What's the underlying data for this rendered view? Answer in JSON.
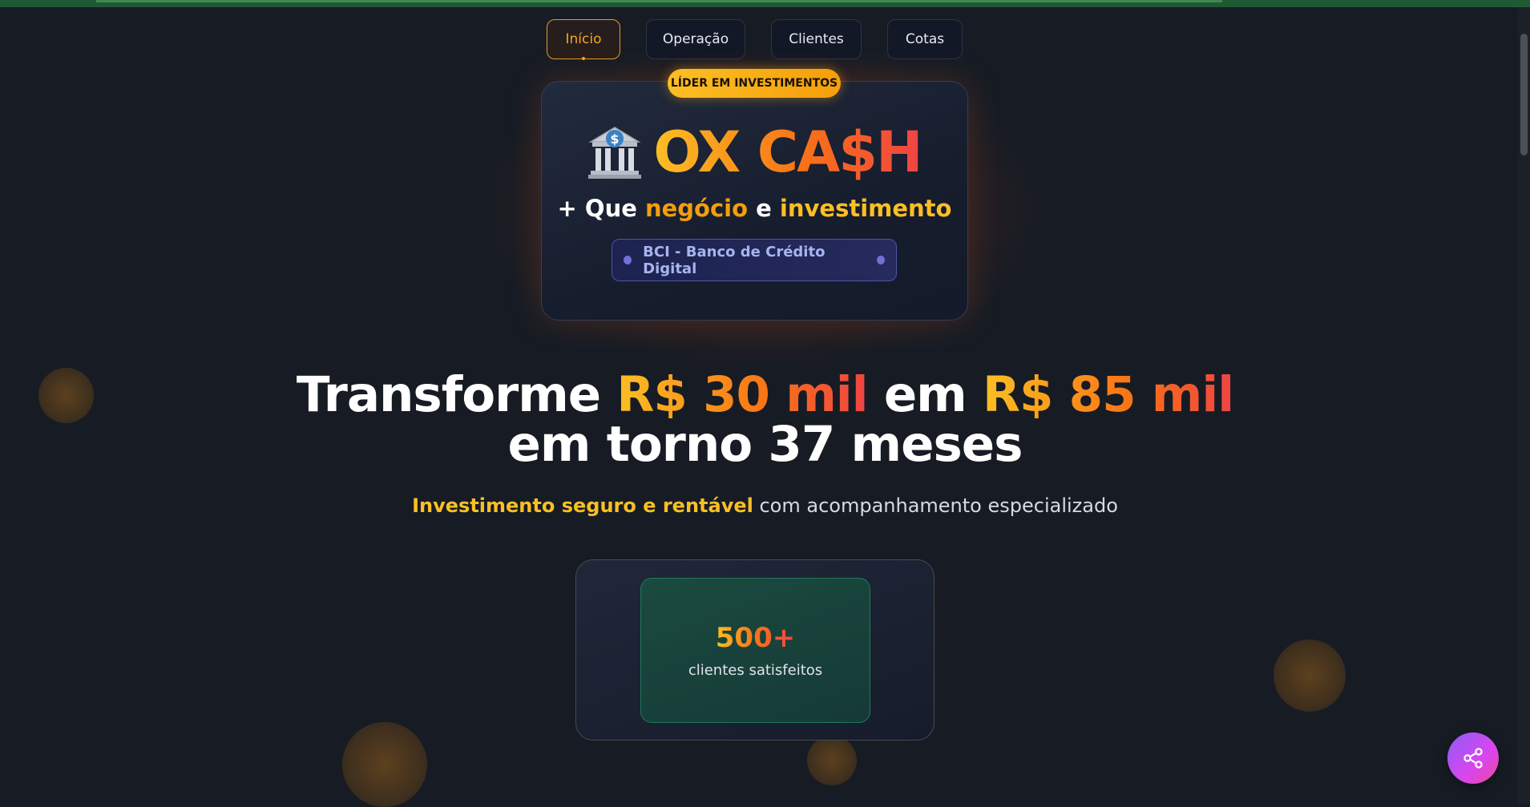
{
  "nav": {
    "items": [
      {
        "label": "Início",
        "active": true
      },
      {
        "label": "Operação",
        "active": false
      },
      {
        "label": "Clientes",
        "active": false
      },
      {
        "label": "Cotas",
        "active": false
      }
    ]
  },
  "hero": {
    "badge": "LÍDER EM INVESTIMENTOS",
    "icon": "bank-icon",
    "brand": "OX CA$H",
    "tagline": {
      "prefix": "+ Que ",
      "word1": "negócio",
      "middle": " e ",
      "word2": "investimento"
    },
    "bank_label": "BCI - Banco de Crédito Digital"
  },
  "headline": {
    "part1": "Transforme ",
    "amount1": "R$ 30 mil",
    "part2": " em ",
    "amount2": "R$ 85 mil",
    "line2": "em torno 37 meses"
  },
  "subtitle": {
    "highlight": "Investimento seguro e rentável",
    "rest": " com acompanhamento especializado"
  },
  "stats": {
    "value": "500+",
    "label": "clientes satisfeitos"
  },
  "share": {
    "icon": "share-icon"
  },
  "colors": {
    "background": "#171c24",
    "accent_yellow": "#fbbf24",
    "accent_orange": "#f97316",
    "accent_red": "#ef4444",
    "share_purple": "#8b5cf6",
    "share_pink": "#ec4899"
  }
}
